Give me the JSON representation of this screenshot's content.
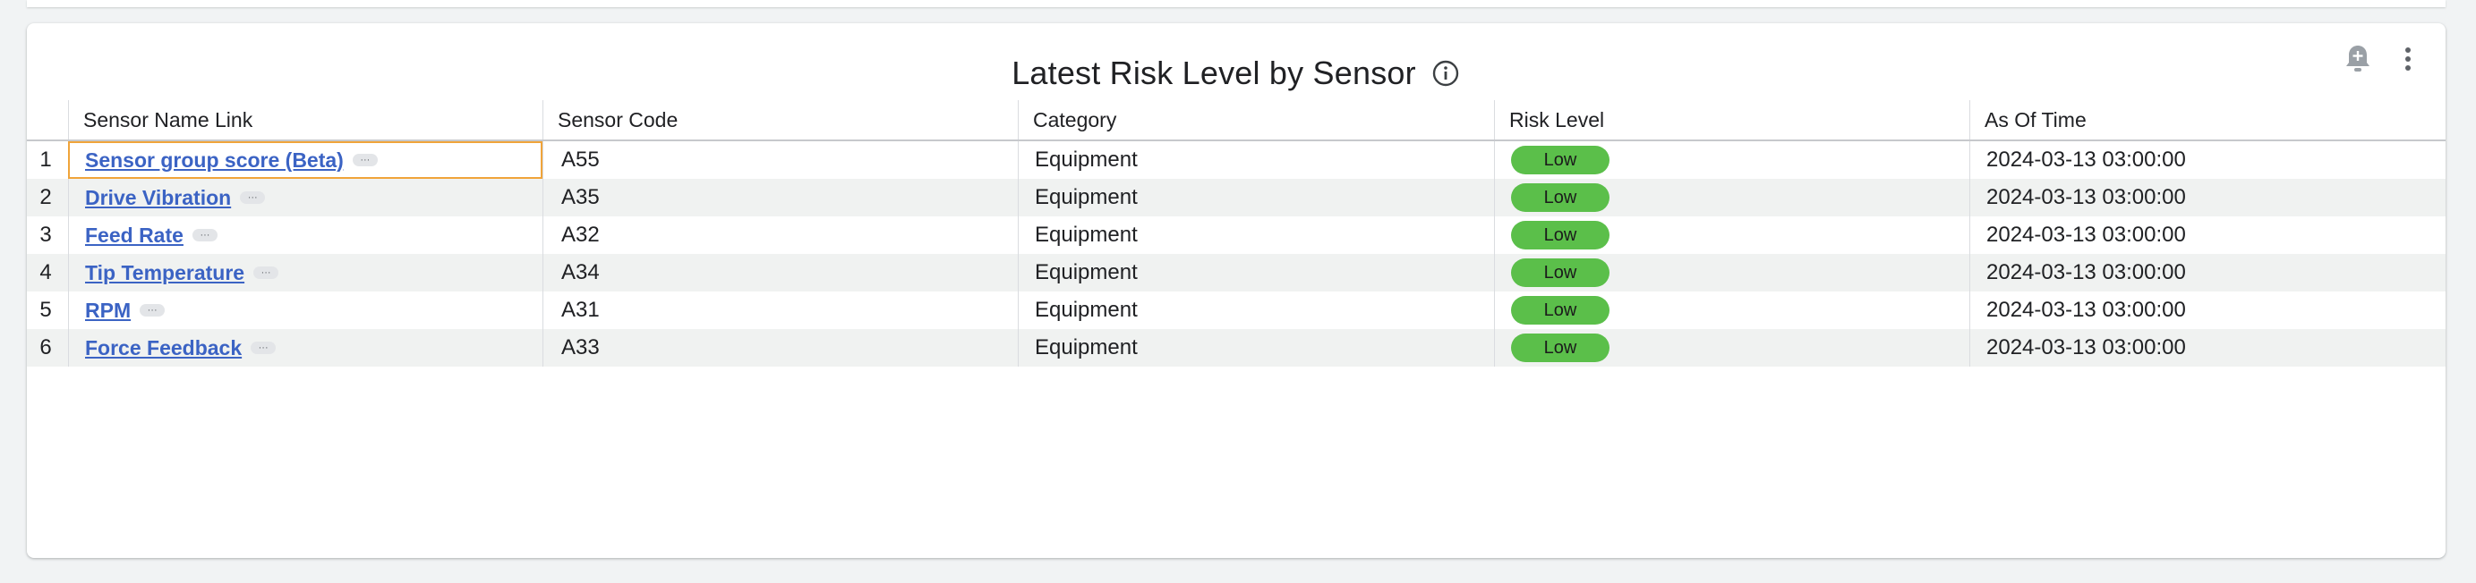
{
  "widget": {
    "title": "Latest Risk Level by Sensor",
    "more_glyph": "···"
  },
  "table": {
    "columns": [
      "Sensor Name Link",
      "Sensor Code",
      "Category",
      "Risk Level",
      "As Of Time"
    ],
    "rows": [
      {
        "index": "1",
        "name": "Sensor group score (Beta)",
        "code": "A55",
        "category": "Equipment",
        "risk": "Low",
        "time": "2024-03-13 03:00:00"
      },
      {
        "index": "2",
        "name": "Drive Vibration",
        "code": "A35",
        "category": "Equipment",
        "risk": "Low",
        "time": "2024-03-13 03:00:00"
      },
      {
        "index": "3",
        "name": "Feed Rate",
        "code": "A32",
        "category": "Equipment",
        "risk": "Low",
        "time": "2024-03-13 03:00:00"
      },
      {
        "index": "4",
        "name": "Tip Temperature",
        "code": "A34",
        "category": "Equipment",
        "risk": "Low",
        "time": "2024-03-13 03:00:00"
      },
      {
        "index": "5",
        "name": "RPM",
        "code": "A31",
        "category": "Equipment",
        "risk": "Low",
        "time": "2024-03-13 03:00:00"
      },
      {
        "index": "6",
        "name": "Force Feedback",
        "code": "A33",
        "category": "Equipment",
        "risk": "Low",
        "time": "2024-03-13 03:00:00"
      }
    ]
  },
  "colors": {
    "link": "#3b63c4",
    "risk_low": "#5bbf4a",
    "selection": "#f0a43a",
    "row_alt": "#f0f2f1"
  },
  "icons": {
    "info": "info-icon",
    "add_alert": "add-alert-icon",
    "more": "more-vert-icon"
  }
}
